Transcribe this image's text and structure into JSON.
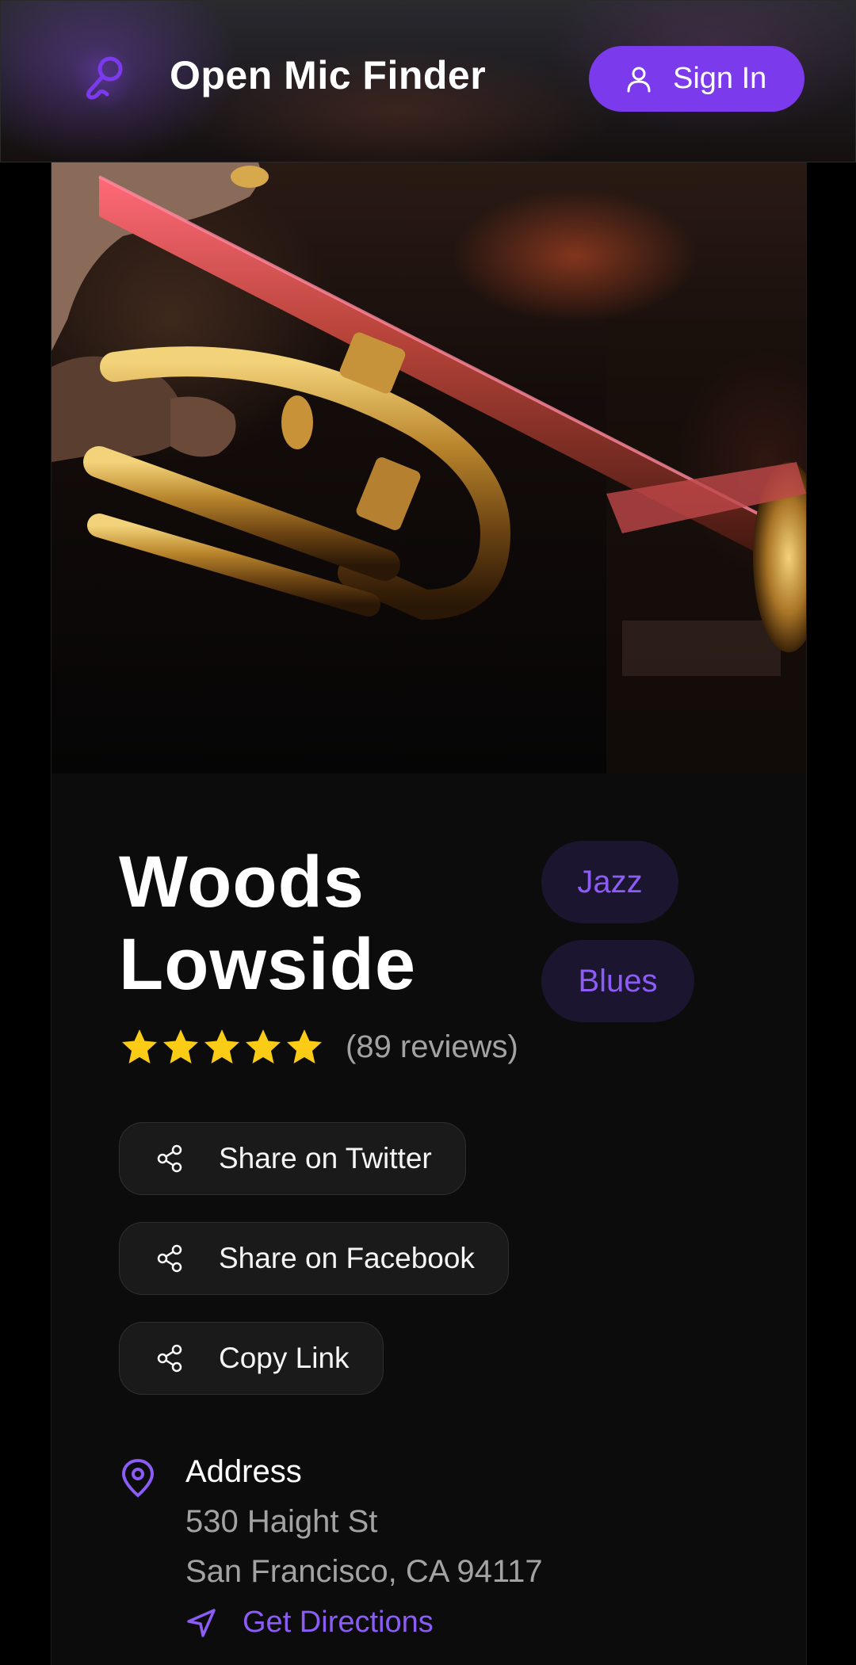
{
  "header": {
    "app_title": "Open Mic Finder",
    "logo_icon": "microphone-icon",
    "signin_label": "Sign In",
    "signin_icon": "user-icon"
  },
  "hero": {
    "image": "trumpet-photo"
  },
  "venue": {
    "name": "Woods Lowside",
    "tags": [
      "Jazz",
      "Blues"
    ],
    "rating": 5,
    "rating_max": 5,
    "reviews_text": "(89 reviews)"
  },
  "share": {
    "twitter_label": "Share on Twitter",
    "facebook_label": "Share on Facebook",
    "copy_label": "Copy Link",
    "icon": "share-icon"
  },
  "address": {
    "heading": "Address",
    "line1": "530 Haight St",
    "line2": "San Francisco, CA 94117",
    "directions_label": "Get Directions",
    "pin_icon": "map-pin-icon",
    "directions_icon": "navigation-icon"
  },
  "colors": {
    "accent": "#7c3aed",
    "accent_text": "#8b5cf6",
    "star": "#facc15",
    "background": "#0c0c0c"
  }
}
